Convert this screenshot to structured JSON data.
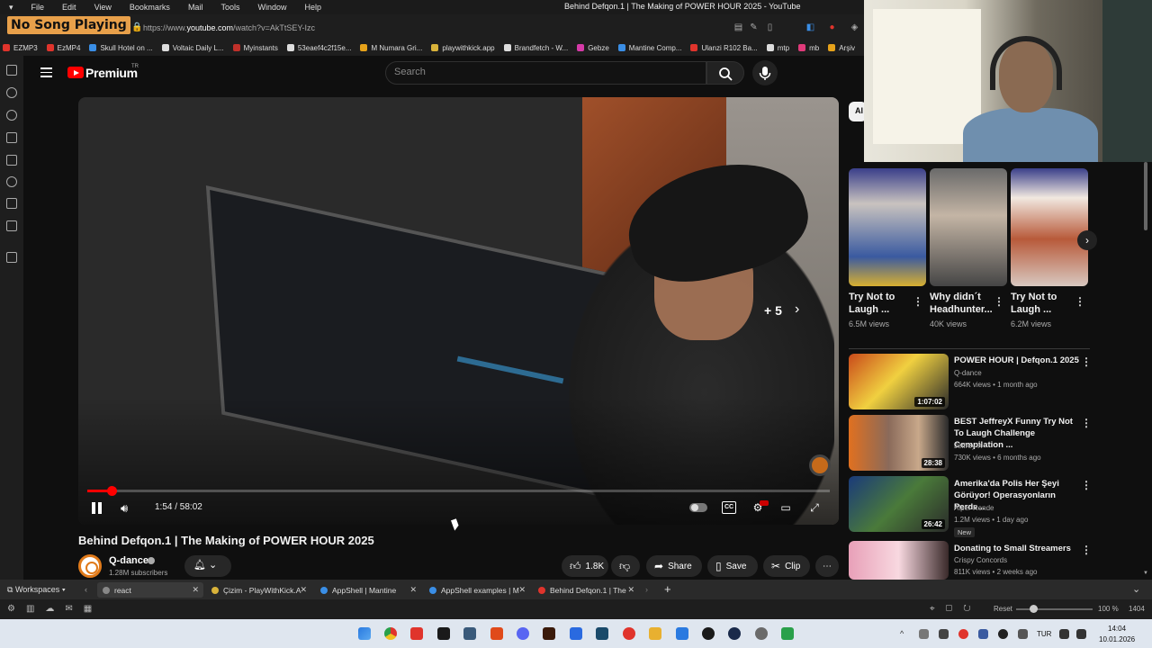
{
  "menubar": {
    "items": [
      "File",
      "Edit",
      "View",
      "Bookmarks",
      "Mail",
      "Tools",
      "Window",
      "Help"
    ],
    "window_title": "Behind Defqon.1 | The Making of POWER HOUR 2025 - YouTube"
  },
  "overlay": {
    "now_playing": "No Song Playing"
  },
  "address": {
    "prefix": "https://www.",
    "host": "youtube.com",
    "path": "/watch?v=AkTtSEY-Izc"
  },
  "bookmarks": [
    {
      "label": "EZMP3",
      "color": "#e0342c"
    },
    {
      "label": "EzMP4",
      "color": "#e0342c"
    },
    {
      "label": "Skull Hotel on ...",
      "color": "#3a8ee6"
    },
    {
      "label": "Voltaic Daily L...",
      "color": "#dddddd"
    },
    {
      "label": "Myinstants",
      "color": "#c0302a"
    },
    {
      "label": "53eaef4c2f15e...",
      "color": "#dddddd"
    },
    {
      "label": "M Numara Gri...",
      "color": "#e6a21a"
    },
    {
      "label": "playwithkick.app",
      "color": "#d9b33a"
    },
    {
      "label": "Brandfetch - W...",
      "color": "#dddddd"
    },
    {
      "label": "Gebze",
      "color": "#d63aa8"
    },
    {
      "label": "Mantine Comp...",
      "color": "#3a8ee6"
    },
    {
      "label": "Ulanzi R102 Ba...",
      "color": "#e0342c"
    },
    {
      "label": "mtp",
      "color": "#dddddd"
    },
    {
      "label": "mb",
      "color": "#e03a7a"
    },
    {
      "label": "Arşiv",
      "color": "#e6a21a"
    }
  ],
  "youtube": {
    "brand": "Premium",
    "region": "TR",
    "search_placeholder": "Search",
    "chip_label": "Al"
  },
  "player": {
    "time": "1:54 / 58:02",
    "progress": 0.0328,
    "overlay_more": "+ 5",
    "cc_label": "CC"
  },
  "video": {
    "title": "Behind Defqon.1 | The Making of POWER HOUR 2025",
    "channel": "Q-dance",
    "subscribers": "1.28M subscribers",
    "likes": "1.8K",
    "share_label": "Share",
    "save_label": "Save",
    "clip_label": "Clip"
  },
  "shorts": [
    {
      "title": "Try Not to Laugh ...",
      "views": "6.5M views"
    },
    {
      "title": "Why didn´t Headhunter...",
      "views": "40K views"
    },
    {
      "title": "Try Not to Laugh ...",
      "views": "6.2M views"
    }
  ],
  "recommendations": [
    {
      "title": "POWER HOUR | Defqon.1 2025",
      "channel": "Q-dance",
      "meta": "664K views • 1 month ago",
      "duration": "1:07:02",
      "badge": ""
    },
    {
      "title": "BEST JeffreyX Funny Try Not To Laugh Challenge Compilation ...",
      "channel": "Jeffrey X",
      "meta": "730K views • 6 months ago",
      "duration": "28:38",
      "badge": ""
    },
    {
      "title": "Amerika'da Polis Her Şeyi Görüyor! Operasyonların Perde...",
      "channel": "Alper Rende",
      "meta": "1.2M views • 1 day ago",
      "duration": "26:42",
      "badge": "New"
    },
    {
      "title": "Donating to Small Streamers",
      "channel": "Crispy Concords",
      "meta": "811K views • 2 weeks ago",
      "duration": "",
      "badge": ""
    }
  ],
  "tabs": {
    "workspaces_label": "Workspaces",
    "items": [
      {
        "label": "react",
        "color": "#888888",
        "active": true
      },
      {
        "label": "Çizim - PlayWithKick.A",
        "color": "#d9b33a",
        "active": false
      },
      {
        "label": "AppShell | Mantine",
        "color": "#3a8ee6",
        "active": false
      },
      {
        "label": "AppShell examples | M",
        "color": "#3a8ee6",
        "active": false
      },
      {
        "label": "Behind Defqon.1 | The",
        "color": "#e0342c",
        "active": false
      }
    ]
  },
  "statusbar": {
    "reset_label": "Reset",
    "zoom": "100 %",
    "clock": "1404"
  },
  "taskbar": {
    "lang": "TUR",
    "time": "14:04",
    "date": "10.01.2026"
  }
}
